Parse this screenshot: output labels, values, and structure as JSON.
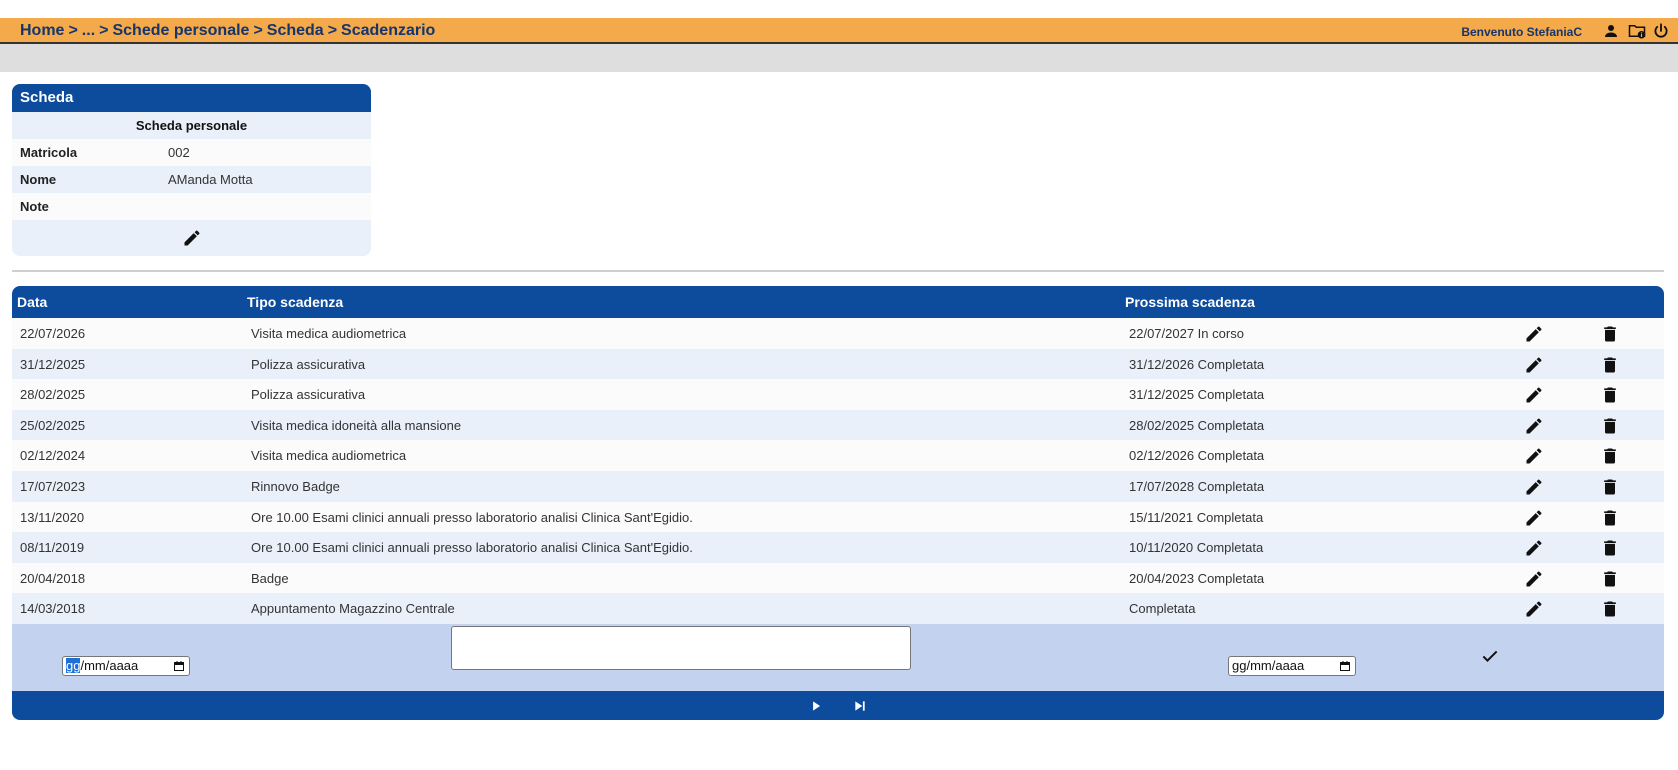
{
  "header": {
    "breadcrumb": [
      "Home",
      "...",
      "Schede personale",
      "Scheda",
      "Scadenzario"
    ],
    "breadcrumb_sep": ">",
    "welcome": "Benvenuto StefaniaC",
    "icons": [
      "user-icon",
      "folder-info-icon",
      "power-icon"
    ]
  },
  "scheda": {
    "title": "Scheda",
    "subtitle": "Scheda personale",
    "fields": [
      {
        "label": "Matricola",
        "value": "002"
      },
      {
        "label": "Nome",
        "value": "AManda Motta"
      },
      {
        "label": "Note",
        "value": ""
      }
    ],
    "edit_icon": "pencil-icon"
  },
  "table": {
    "columns": [
      "Data",
      "Tipo scadenza",
      "Prossima scadenza"
    ],
    "rows": [
      {
        "data": "22/07/2026",
        "tipo": "Visita medica audiometrica",
        "prossima": "22/07/2027 In corso"
      },
      {
        "data": "31/12/2025",
        "tipo": "Polizza assicurativa",
        "prossima": "31/12/2026 Completata"
      },
      {
        "data": "28/02/2025",
        "tipo": "Polizza assicurativa",
        "prossima": "31/12/2025 Completata"
      },
      {
        "data": "25/02/2025",
        "tipo": "Visita medica idoneità alla mansione",
        "prossima": "28/02/2025 Completata"
      },
      {
        "data": "02/12/2024",
        "tipo": "Visita medica audiometrica",
        "prossima": "02/12/2026 Completata"
      },
      {
        "data": "17/07/2023",
        "tipo": "Rinnovo Badge",
        "prossima": "17/07/2028 Completata"
      },
      {
        "data": "13/11/2020",
        "tipo": "Ore 10.00 Esami clinici annuali presso laboratorio analisi Clinica Sant'Egidio.",
        "prossima": "15/11/2021 Completata"
      },
      {
        "data": "08/11/2019",
        "tipo": "Ore 10.00 Esami clinici annuali presso laboratorio analisi Clinica Sant'Egidio.",
        "prossima": "10/11/2020 Completata"
      },
      {
        "data": "20/04/2018",
        "tipo": "Badge",
        "prossima": "20/04/2023 Completata"
      },
      {
        "data": "14/03/2018",
        "tipo": "Appuntamento Magazzino Centrale",
        "prossima": "Completata"
      }
    ],
    "row_icons": [
      "pencil-icon",
      "trash-icon"
    ],
    "new_row": {
      "date_day": "gg",
      "date_rest": "/mm/aaaa",
      "date2": "gg/mm/aaaa",
      "confirm_icon": "check-icon"
    },
    "footer_icons": [
      "next-page-icon",
      "last-page-icon"
    ]
  },
  "colors": {
    "topbar": "#f4a94a",
    "header_blue": "#0d4c9c",
    "row_alt": "#e9f0fa",
    "new_row_bg": "#c3d2ef"
  }
}
